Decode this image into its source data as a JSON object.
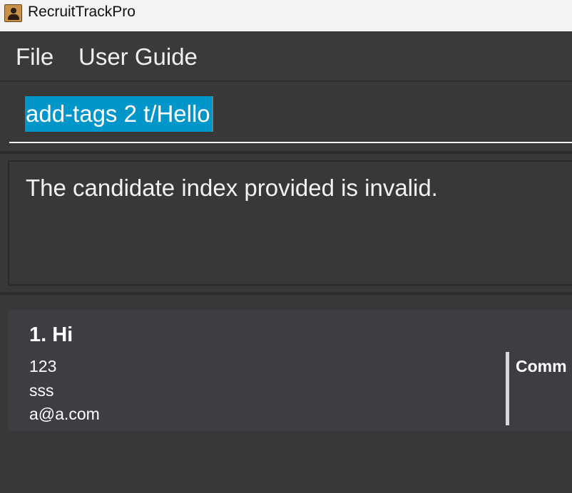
{
  "window": {
    "title": "RecruitTrackPro",
    "icon": "contact-card-icon"
  },
  "menu": {
    "items": [
      "File",
      "User Guide"
    ]
  },
  "command": {
    "value": "add-tags 2 t/Hello",
    "selected": true
  },
  "result": {
    "message": "The candidate index provided is invalid."
  },
  "candidates": [
    {
      "index_name": "1. Hi",
      "phone": "123",
      "address": "sss",
      "email": "a@a.com",
      "comment_label": "Comm"
    }
  ],
  "colors": {
    "selection": "#0096c9",
    "background": "#383838",
    "card": "#3c3e42"
  }
}
